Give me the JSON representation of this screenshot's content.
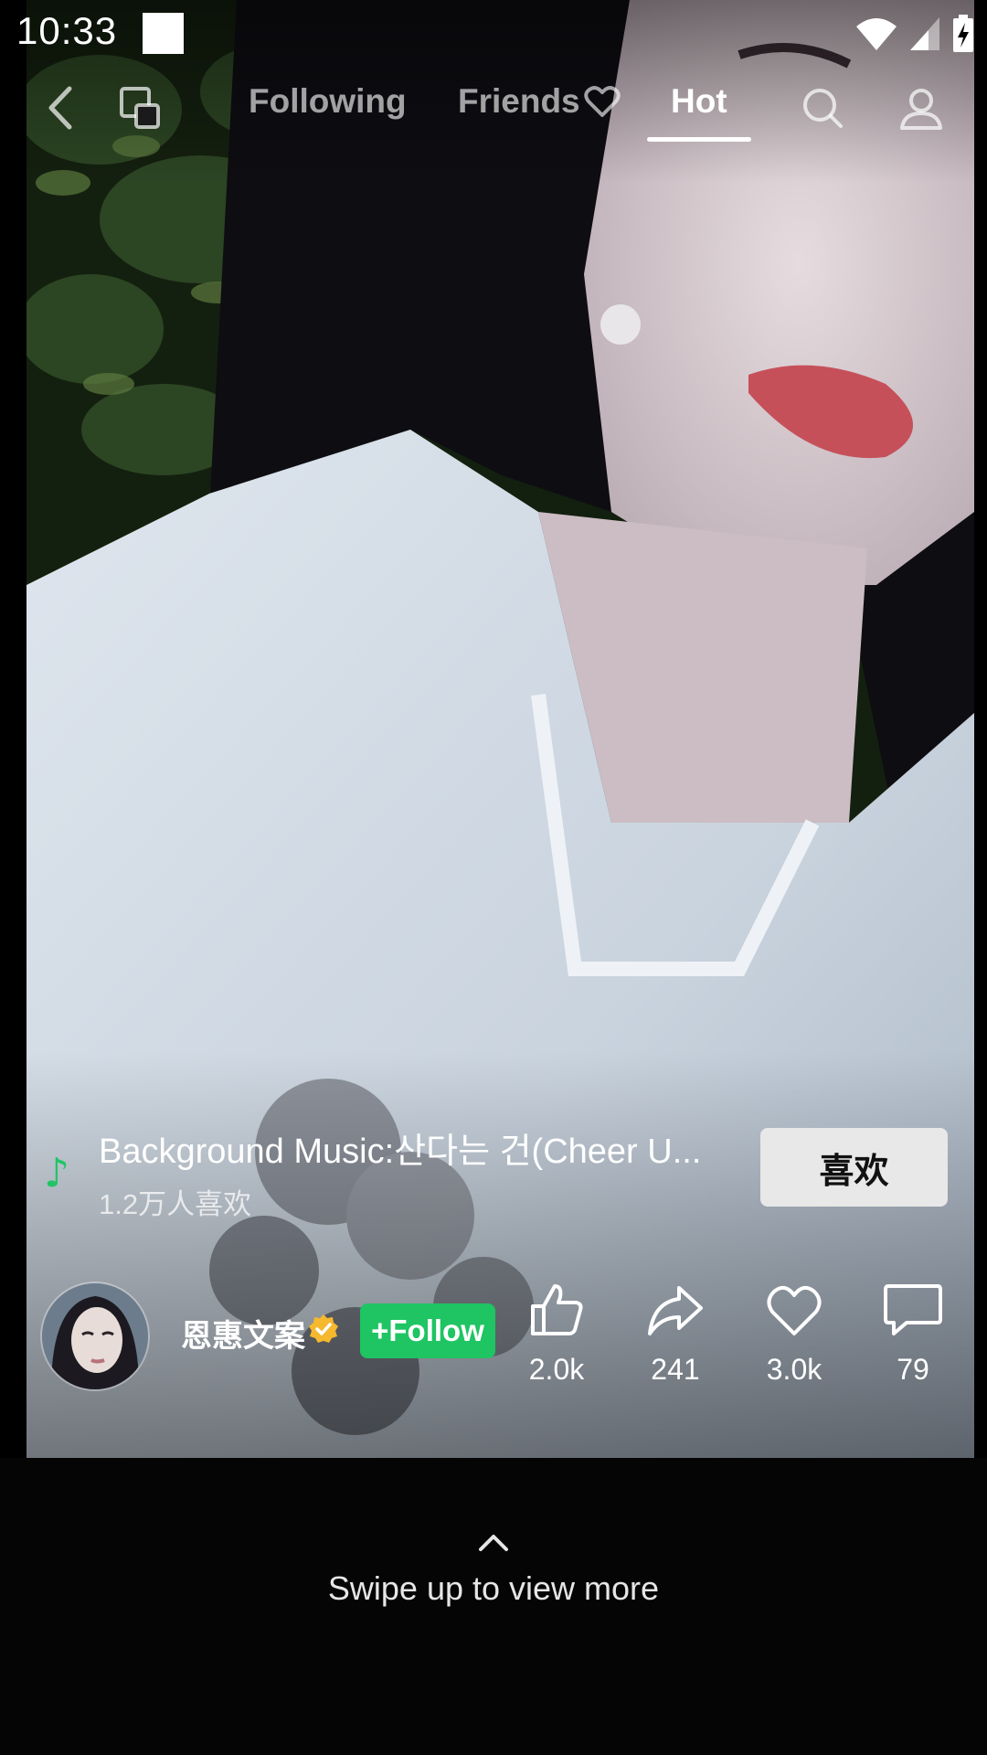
{
  "status_bar": {
    "time": "10:33"
  },
  "top_nav": {
    "tabs": [
      {
        "label": "Following"
      },
      {
        "label": "Friends"
      },
      {
        "label": "Hot"
      }
    ],
    "active_tab": "Hot",
    "icons": [
      "back-icon",
      "screen-cast-icon",
      "search-icon",
      "profile-icon"
    ]
  },
  "music": {
    "title": "Background Music:산다는 건(Cheer U...",
    "likes": "1.2万人喜欢",
    "like_button": "喜欢"
  },
  "author": {
    "name": "恩惠文案",
    "follow_label": "+Follow"
  },
  "stats": {
    "likes": "2.0k",
    "shares": "241",
    "favorites": "3.0k",
    "comments": "79"
  },
  "bottom": {
    "swipe_hint": "Swipe up to view more"
  },
  "colors": {
    "accent_green": "#1fc463",
    "music_note": "#20c566",
    "verified_badge": "#f5b82e"
  }
}
